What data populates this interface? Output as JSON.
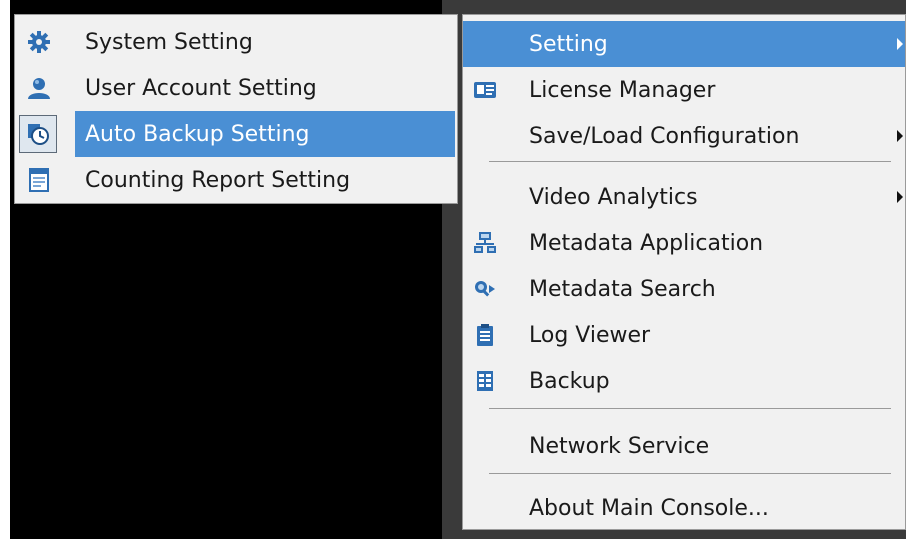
{
  "main_menu": {
    "items": [
      {
        "label": "Setting",
        "icon": "none",
        "has_submenu": true,
        "highlighted": true
      },
      {
        "label": "License Manager",
        "icon": "license-card-icon",
        "has_submenu": false
      },
      {
        "label": "Save/Load Configuration",
        "icon": "none",
        "has_submenu": true
      },
      {
        "label": "Video Analytics",
        "icon": "none",
        "has_submenu": true
      },
      {
        "label": "Metadata Application",
        "icon": "network-computers-icon",
        "has_submenu": false
      },
      {
        "label": "Metadata Search",
        "icon": "magnifier-search-icon",
        "has_submenu": false
      },
      {
        "label": "Log Viewer",
        "icon": "clipboard-icon",
        "has_submenu": false
      },
      {
        "label": "Backup",
        "icon": "backup-icon",
        "has_submenu": false
      },
      {
        "label": "Network Service",
        "icon": "none",
        "has_submenu": false
      },
      {
        "label": "About Main Console...",
        "icon": "none",
        "has_submenu": false
      }
    ]
  },
  "sub_menu": {
    "items": [
      {
        "label": "System Setting",
        "icon": "gear-icon"
      },
      {
        "label": "User Account Setting",
        "icon": "user-icon"
      },
      {
        "label": "Auto Backup Setting",
        "icon": "clock-backup-icon",
        "highlighted": true
      },
      {
        "label": "Counting Report Setting",
        "icon": "report-sheet-icon"
      }
    ]
  },
  "colors": {
    "highlight": "#4a8fd4",
    "menu_bg": "#f1f1f1",
    "backdrop": "#000000"
  }
}
